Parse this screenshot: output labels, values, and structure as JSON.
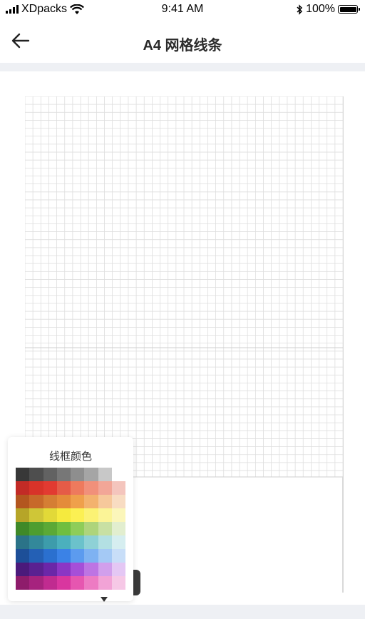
{
  "status_bar": {
    "carrier": "XDpacks",
    "time": "9:41 AM",
    "battery": "100%"
  },
  "nav": {
    "title": "A4 网格线条"
  },
  "grid": {
    "line_color": "#dedede",
    "major_line_color": "#cfcfcf"
  },
  "color_popup": {
    "title": "线框颜色",
    "rows": [
      [
        "#383838",
        "#4e4e4e",
        "#626262",
        "#777777",
        "#8e8e8e",
        "#a5a5a5",
        "#c8c8c8",
        "#ffffff"
      ],
      [
        "#c22b26",
        "#d83329",
        "#e23a31",
        "#e55b47",
        "#ee7a5d",
        "#f1907a",
        "#f2a697",
        "#f4c5bd"
      ],
      [
        "#b3561f",
        "#c7692a",
        "#d57e34",
        "#e48b3a",
        "#efa04b",
        "#f3b26e",
        "#f6c89b",
        "#f8dcc2"
      ],
      [
        "#b6a528",
        "#cfc637",
        "#e2d938",
        "#f5ea3e",
        "#fbf053",
        "#fbf274",
        "#fbf497",
        "#fbf6ba"
      ],
      [
        "#3f8928",
        "#4e9d30",
        "#5ba936",
        "#6fbe3f",
        "#8ecd59",
        "#aed47b",
        "#c8e0a3",
        "#e2eecf"
      ],
      [
        "#2b7388",
        "#33889a",
        "#3d9cab",
        "#4bb0bd",
        "#6bc2cb",
        "#8ed1d6",
        "#b3e0e3",
        "#d6eef0"
      ],
      [
        "#1d4f98",
        "#2460b5",
        "#2b70cf",
        "#3b82e6",
        "#5c9bef",
        "#7eb2f2",
        "#a4c9f5",
        "#c8def8"
      ],
      [
        "#4b1a7b",
        "#5a2191",
        "#6b27a8",
        "#8b36c5",
        "#a64fd8",
        "#bd74e3",
        "#d19fec",
        "#e4c7f4"
      ],
      [
        "#8e1c6b",
        "#a6237e",
        "#c02b90",
        "#d9369f",
        "#e656b0",
        "#ed7bc3",
        "#f2a3d6",
        "#f6c8e6"
      ]
    ]
  }
}
